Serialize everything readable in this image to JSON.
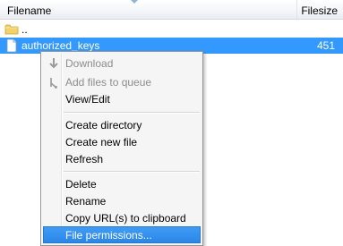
{
  "header": {
    "filename_label": "Filename",
    "filesize_label": "Filesize"
  },
  "rows": [
    {
      "name": "..",
      "size": "",
      "icon": "folder-icon"
    },
    {
      "name": "authorized_keys",
      "size": "451",
      "icon": "file-icon",
      "selected": true
    }
  ],
  "context_menu": {
    "download": "Download",
    "add_to_queue": "Add files to queue",
    "view_edit": "View/Edit",
    "create_directory": "Create directory",
    "create_file": "Create new file",
    "refresh": "Refresh",
    "delete": "Delete",
    "rename": "Rename",
    "copy_url": "Copy URL(s) to clipboard",
    "file_permissions": "File permissions..."
  },
  "colors": {
    "selection": "#3399ff",
    "menu_background": "#f5f5f5",
    "disabled_text": "#8d8d8d"
  }
}
